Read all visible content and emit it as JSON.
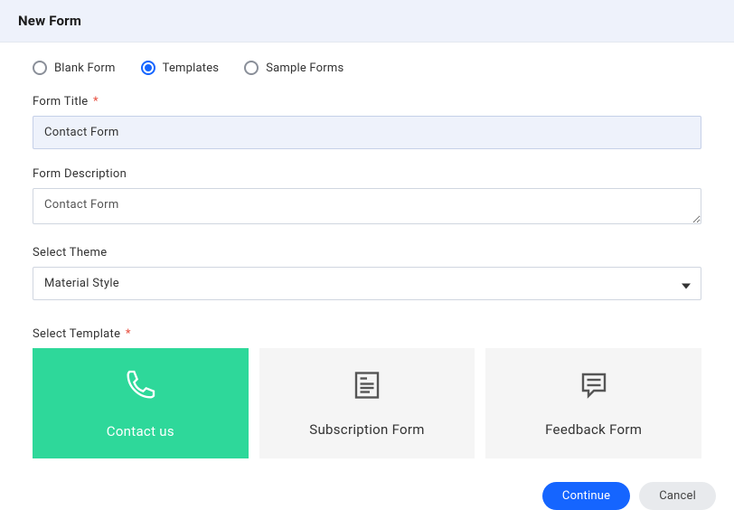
{
  "header": {
    "title": "New Form"
  },
  "formType": {
    "options": [
      {
        "label": "Blank Form",
        "selected": false
      },
      {
        "label": "Templates",
        "selected": true
      },
      {
        "label": "Sample Forms",
        "selected": false
      }
    ]
  },
  "fields": {
    "formTitle": {
      "label": "Form Title",
      "required": true,
      "value": "Contact Form"
    },
    "formDescription": {
      "label": "Form Description",
      "required": false,
      "value": "Contact Form"
    },
    "selectTheme": {
      "label": "Select Theme",
      "required": false,
      "value": "Material Style"
    },
    "selectTemplate": {
      "label": "Select Template",
      "required": true,
      "options": [
        {
          "label": "Contact us",
          "icon": "phone",
          "selected": true
        },
        {
          "label": "Subscription Form",
          "icon": "document",
          "selected": false
        },
        {
          "label": "Feedback Form",
          "icon": "chat",
          "selected": false
        }
      ]
    }
  },
  "footer": {
    "continue": "Continue",
    "cancel": "Cancel"
  },
  "requiredMark": "*"
}
